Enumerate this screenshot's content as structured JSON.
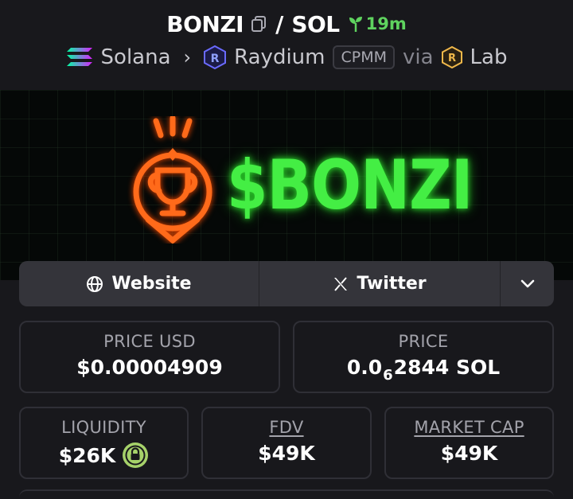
{
  "header": {
    "base_token": "BONZI",
    "separator": "/",
    "quote_token": "SOL",
    "age": "19m"
  },
  "chain_row": {
    "chain": "Solana",
    "dex": "Raydium",
    "pool_type": "CPMM",
    "via": "via",
    "launchpad": "Lab"
  },
  "banner": {
    "text": "$BONZI"
  },
  "links": {
    "website": "Website",
    "twitter": "Twitter"
  },
  "stats": {
    "price_usd": {
      "label": "PRICE USD",
      "value": "$0.00004909"
    },
    "price_sol": {
      "label": "PRICE",
      "prefix": "0.0",
      "zeros": "6",
      "suffix": "2844 SOL"
    },
    "liquidity": {
      "label": "LIQUIDITY",
      "value": "$26K"
    },
    "fdv": {
      "label": "FDV",
      "value": "$49K"
    },
    "market_cap": {
      "label": "MARKET CAP",
      "value": "$49K"
    }
  },
  "colors": {
    "background": "#18181c",
    "age_green": "#5fd35f",
    "banner_green": "#44ee44",
    "banner_orange": "#ff6a1a",
    "lock_green": "#a6d26a"
  },
  "icons": {
    "copy": "copy-icon",
    "age": "seedling-icon",
    "solana": "solana-icon",
    "raydium": "raydium-icon",
    "launchpad": "raydium-launchlab-icon",
    "website": "globe-icon",
    "twitter": "x-logo-icon",
    "more": "chevron-down-icon",
    "liquidity_lock": "lock-icon"
  }
}
